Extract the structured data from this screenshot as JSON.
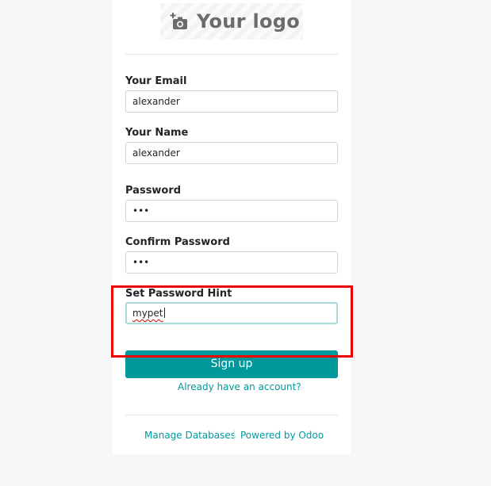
{
  "logo": {
    "text": "Your logo",
    "icon": "camera-plus-icon"
  },
  "form": {
    "email": {
      "label": "Your Email",
      "value": "alexander"
    },
    "name": {
      "label": "Your Name",
      "value": "alexander"
    },
    "password": {
      "label": "Password",
      "value": "•••"
    },
    "confirm_password": {
      "label": "Confirm Password",
      "value": "•••"
    },
    "password_hint": {
      "label": "Set Password Hint",
      "value": "mypet"
    },
    "submit_label": "Sign up",
    "login_link": "Already have an account?"
  },
  "footer": {
    "manage_databases": "Manage Databases",
    "powered_by": "Powered by Odoo"
  },
  "colors": {
    "accent": "#00999b",
    "highlight": "#ee0000",
    "focus_border": "#a8d9db"
  }
}
